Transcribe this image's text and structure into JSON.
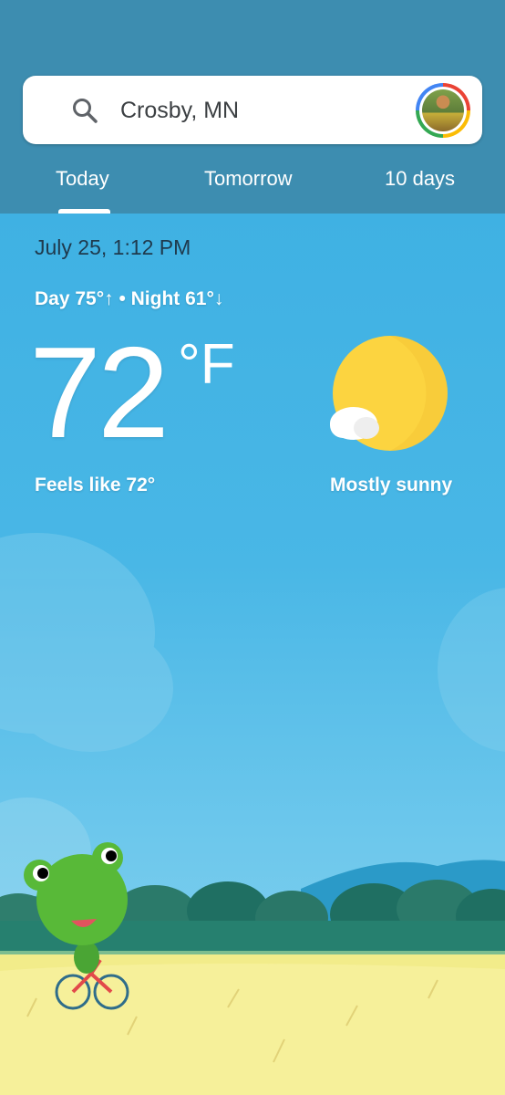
{
  "search": {
    "location": "Crosby, MN"
  },
  "tabs": [
    {
      "label": "Today",
      "selected": true
    },
    {
      "label": "Tomorrow",
      "selected": false
    },
    {
      "label": "10 days",
      "selected": false
    }
  ],
  "weather": {
    "datetime": "July 25, 1:12 PM",
    "day_night": "Day 75°↑ • Night 61°↓",
    "temperature": "72",
    "unit": "°F",
    "feels_like": "Feels like 72°",
    "condition": "Mostly sunny",
    "condition_icon": "sun-with-cloud-icon"
  },
  "colors": {
    "header": "#3d8db0",
    "sky": "#4fb6e3",
    "sun": "#fcd440",
    "frog": "#58b938"
  }
}
